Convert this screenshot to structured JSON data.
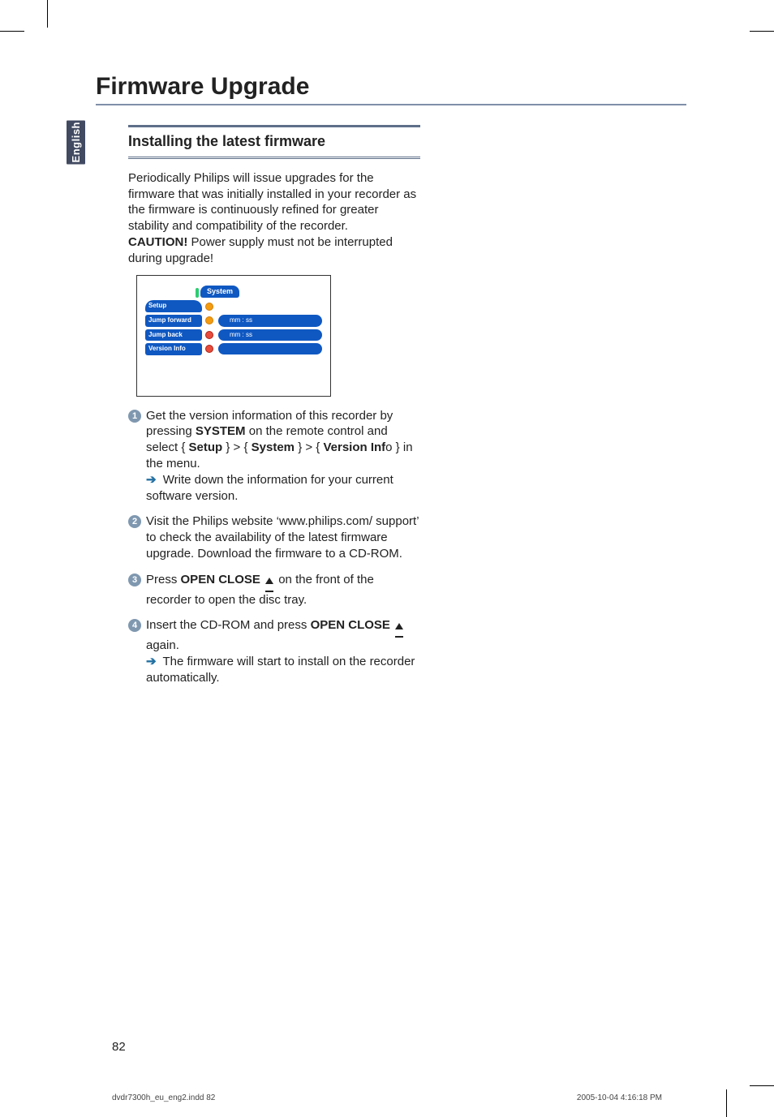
{
  "page": {
    "title": "Firmware Upgrade",
    "langTab": "English",
    "pageNumber": "82",
    "footerLeft": "dvdr7300h_eu_eng2.indd   82",
    "footerRight": "2005-10-04   4:16:18 PM"
  },
  "section": {
    "heading": "Installing the latest firmware",
    "intro1": "Periodically Philips will issue upgrades for the firmware that was initially installed in your recorder as the firmware is continuously refined for greater stability and compatibility of the recorder.",
    "cautionLabel": "CAUTION!",
    "cautionText": " Power supply must not be interrupted during upgrade!"
  },
  "ui": {
    "tabTitle": "System",
    "rows": {
      "setup": "Setup",
      "jumpForward": "Jump forward",
      "jumpForwardVal": "mm : ss",
      "jumpBack": "Jump back",
      "jumpBackVal": "mm : ss",
      "versionInfo": "Version Info"
    }
  },
  "steps": {
    "s1a": "Get the version information of this recorder by pressing ",
    "s1b": "SYSTEM",
    "s1c": " on the remote control and select { ",
    "s1d": "Setup",
    "s1e": " } > { ",
    "s1f": "System",
    "s1g": " } > { ",
    "s1h": "Version Inf",
    "s1i": "o } in the menu.",
    "s1note": " Write down the information for your current software version.",
    "s2": "Visit the Philips website ‘www.philips.com/ support’ to check the availability of the latest firmware upgrade. Download the firmware to a CD-ROM.",
    "s3a": "Press ",
    "s3b": "OPEN CLOSE",
    "s3c": " on the front of the recorder to open the disc tray.",
    "s4a": "Insert the CD-ROM and press ",
    "s4b": "OPEN CLOSE",
    "s4c": " again.",
    "s4note": " The firmware will start to install on the recorder automatically."
  }
}
